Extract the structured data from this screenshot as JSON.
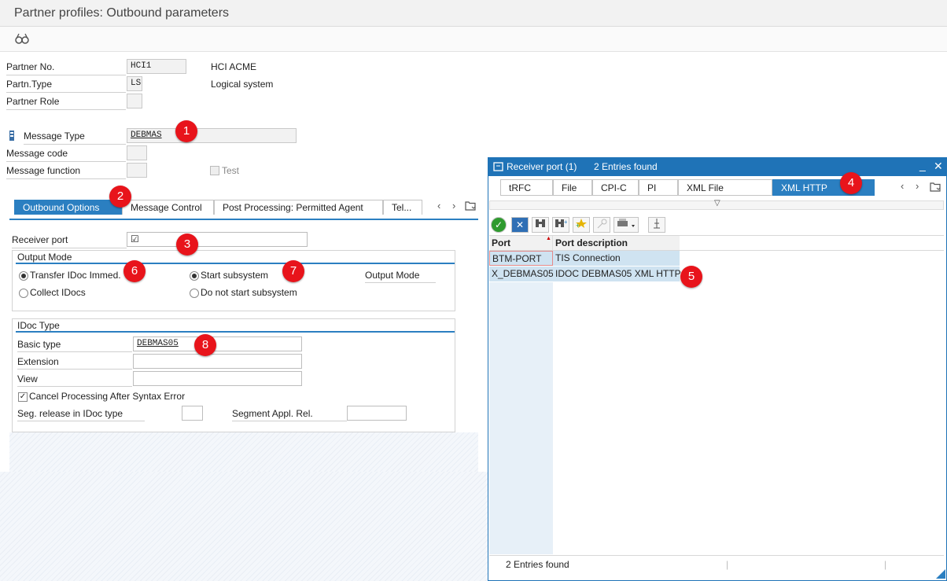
{
  "window": {
    "title": "Partner profiles: Outbound parameters"
  },
  "toolbar": {
    "display_icon": "glasses-icon"
  },
  "header": {
    "partner_no_label": "Partner No.",
    "partner_no_value": "HCI1",
    "partner_no_desc": "HCI ACME",
    "partn_type_label": "Partn.Type",
    "partn_type_value": "LS",
    "partn_type_desc": "Logical system",
    "partner_role_label": "Partner Role",
    "message_type_label": "Message Type",
    "message_type_value": "DEBMAS",
    "message_code_label": "Message code",
    "message_function_label": "Message function",
    "test_label": "Test"
  },
  "badges": [
    "1",
    "2",
    "3",
    "4",
    "5",
    "6",
    "7",
    "8"
  ],
  "tabs": [
    {
      "label": "Outbound Options",
      "active": true
    },
    {
      "label": "Message Control",
      "active": false
    },
    {
      "label": "Post Processing: Permitted Agent",
      "active": false
    },
    {
      "label": "Tel...",
      "active": false
    }
  ],
  "outbound": {
    "receiver_port_label": "Receiver port",
    "receiver_port_icon": "☑",
    "output_mode_title": "Output Mode",
    "transfer_idoc_label": "Transfer IDoc Immed.",
    "collect_idocs_label": "Collect IDocs",
    "start_subsystem_label": "Start subsystem",
    "do_not_start_label": "Do not start subsystem",
    "output_mode_label": "Output Mode",
    "idoc_type_title": "IDoc Type",
    "basic_type_label": "Basic type",
    "basic_type_value": "DEBMAS05",
    "extension_label": "Extension",
    "view_label": "View",
    "cancel_processing_label": "Cancel Processing After Syntax Error",
    "seg_release_label": "Seg. release in IDoc type",
    "segment_appl_label": "Segment Appl. Rel."
  },
  "popup": {
    "title": "Receiver port (1)",
    "entries_found": "2 Entries found",
    "tabs": [
      "tRFC",
      "File",
      "CPI-C",
      "PI",
      "XML File",
      "XML HTTP"
    ],
    "active_tab": "XML HTTP",
    "columns": [
      "Port",
      "Port description"
    ],
    "rows": [
      {
        "port": "BTM-PORT",
        "desc": "TIS Connection"
      },
      {
        "port": "X_DEBMAS05",
        "desc": "IDOC DEBMAS05 XML HTTP"
      }
    ],
    "status_text": "2 Entries found"
  },
  "colors": {
    "accent": "#2b7fc1",
    "popup_header": "#1f73b7",
    "badge": "#e8141b",
    "row_highlight": "#cfe3f1"
  }
}
